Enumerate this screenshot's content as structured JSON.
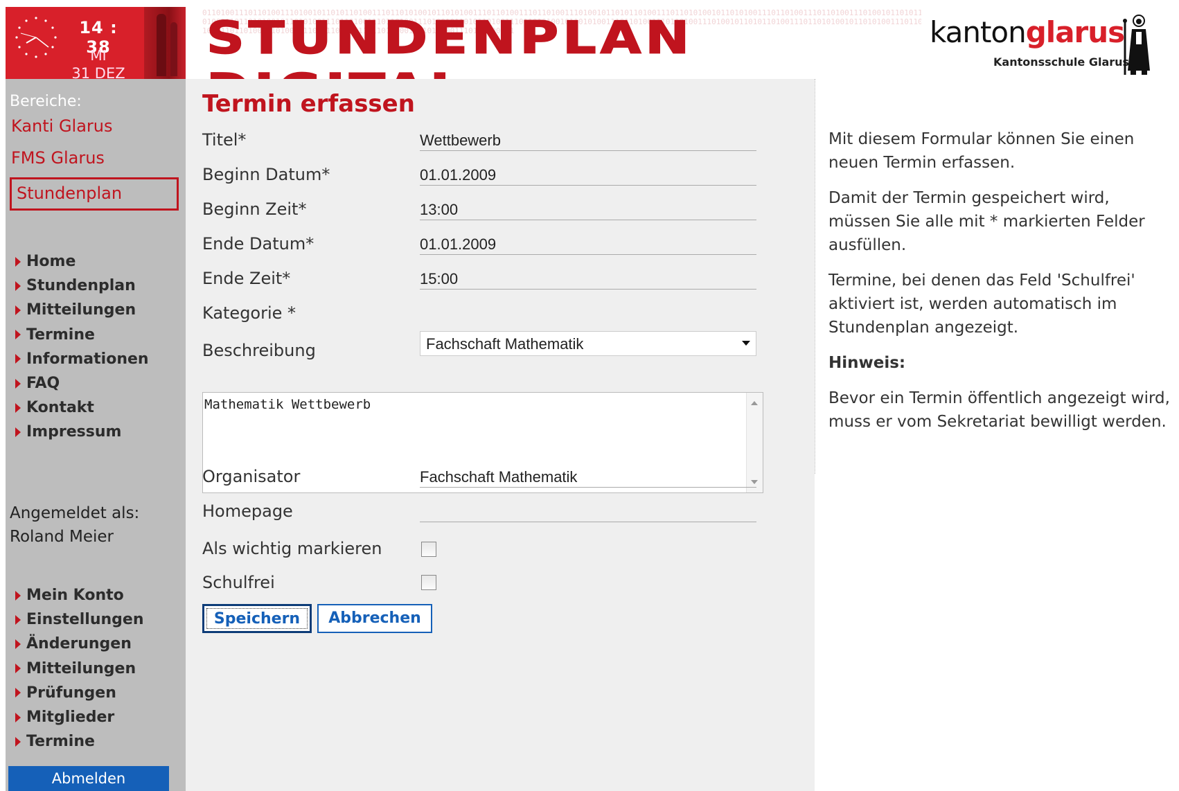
{
  "header": {
    "clock_time": "14 : 38",
    "clock_day": "MI",
    "clock_date": "31 DEZ",
    "banner_title": "STUNDENPLAN DIGITAL",
    "banner_binary": "0110100111011010011101001011010110100111011010100101101010011101101001110110100111010010110101101001110110101001011010100111011010011101101001110100101101011010011101101010010110101001110110100111011010011101001011010110100111011010100101101010011101101001110110100111010010110101101001110110101001011010100111011010011101101001110100101101011010011101101010010110101001110110100111",
    "brand_kanton": "kanton",
    "brand_glarus": "glarus",
    "brand_sub": "Kantonsschule Glarus",
    "accent_color": "#c0141e",
    "clock_bg_color": "#d8202a"
  },
  "sidebar": {
    "areas_label": "Bereiche:",
    "areas": [
      "Kanti Glarus",
      "FMS Glarus",
      "Stundenplan"
    ],
    "main_nav": [
      "Home",
      "Stundenplan",
      "Mitteilungen",
      "Termine",
      "Informationen",
      "FAQ",
      "Kontakt",
      "Impressum"
    ],
    "logged_in_label": "Angemeldet als:",
    "user_name": "Roland Meier",
    "user_nav": [
      "Mein Konto",
      "Einstellungen",
      "Änderungen",
      "Mitteilungen",
      "Prüfungen",
      "Mitglieder",
      "Termine"
    ],
    "logout_label": "Abmelden",
    "logout_color": "#1560b8"
  },
  "form": {
    "page_title": "Termin erfassen",
    "fields": {
      "titel": {
        "label": "Titel*",
        "value": "Wettbewerb"
      },
      "beginn_datum": {
        "label": "Beginn Datum*",
        "value": "01.01.2009"
      },
      "beginn_zeit": {
        "label": "Beginn Zeit*",
        "value": "13:00"
      },
      "ende_datum": {
        "label": "Ende Datum*",
        "value": "01.01.2009"
      },
      "ende_zeit": {
        "label": "Ende Zeit*",
        "value": "15:00"
      },
      "kategorie": {
        "label": "Kategorie *",
        "value": "Fachschaft Mathematik"
      },
      "beschreibung": {
        "label": "Beschreibung",
        "value": "Mathematik Wettbewerb"
      },
      "organisator": {
        "label": "Organisator",
        "value": "Fachschaft Mathematik"
      },
      "homepage": {
        "label": "Homepage",
        "value": ""
      },
      "wichtig": {
        "label": "Als wichtig markieren",
        "checked": false
      },
      "schulfrei": {
        "label": "Schulfrei",
        "checked": false
      }
    },
    "save_label": "Speichern",
    "cancel_label": "Abbrechen"
  },
  "help": {
    "p1": "Mit diesem Formular können Sie einen neuen Termin erfassen.",
    "p2": "Damit der Termin gespeichert wird, müssen Sie alle mit * markierten Felder ausfüllen.",
    "p3": "Termine, bei denen das Feld 'Schulfrei' aktiviert ist, werden automatisch im Stundenplan angezeigt.",
    "hint_label": "Hinweis:",
    "p4": "Bevor ein Termin öffentlich angezeigt wird, muss er vom Sekretariat bewilligt werden."
  }
}
